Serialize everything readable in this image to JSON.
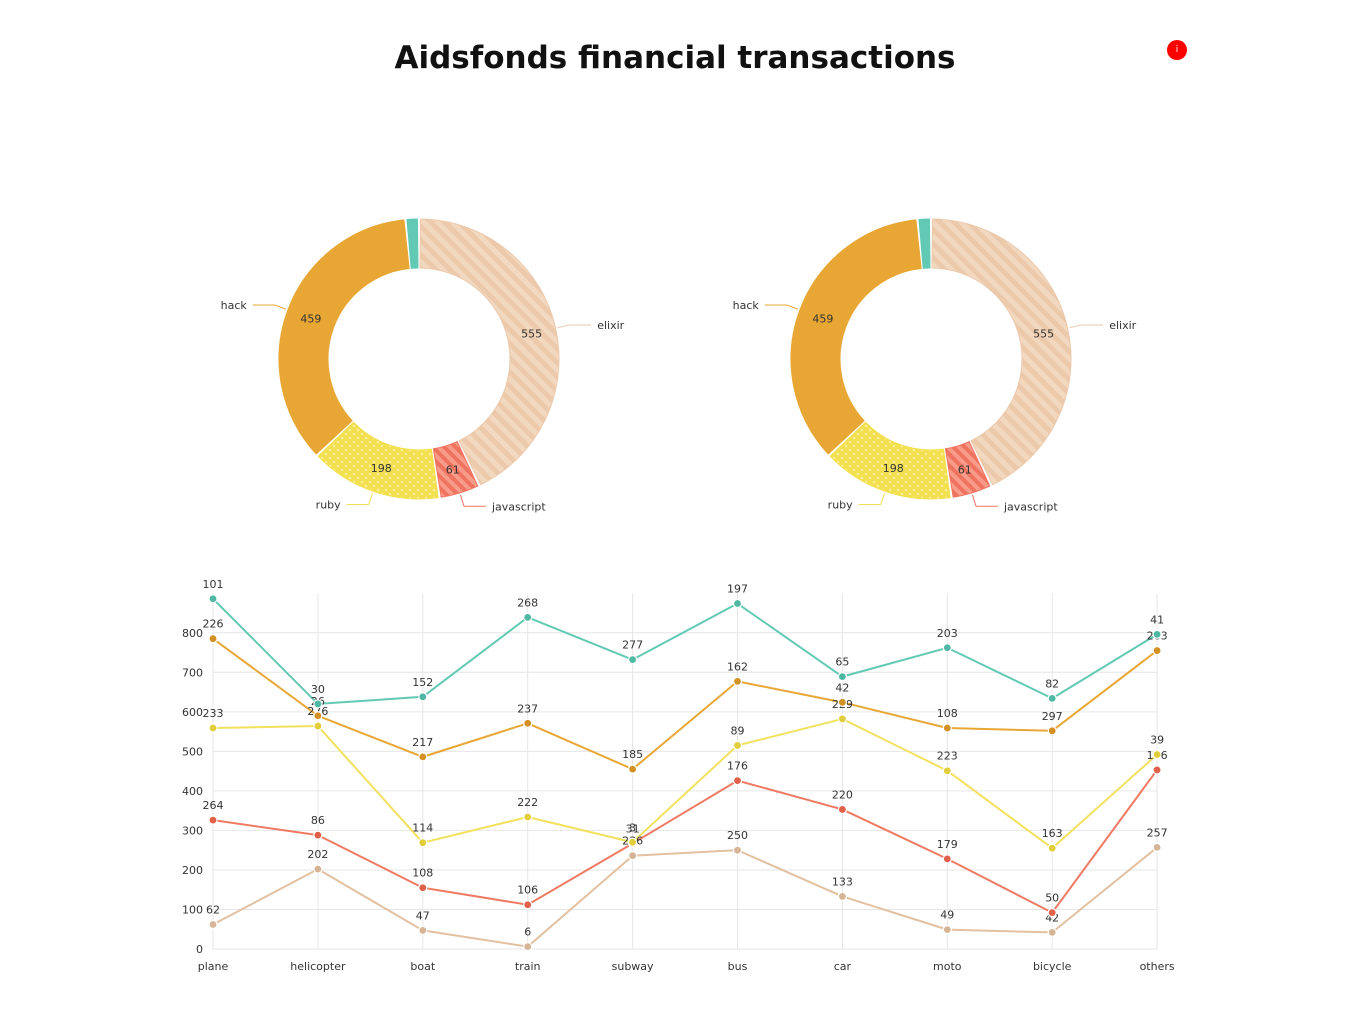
{
  "title": "Aidsfonds financial transactions",
  "info_button_label": "i",
  "chart_data": [
    {
      "type": "pie",
      "variant": "donut",
      "slices": [
        {
          "label": "elixir",
          "value": 555,
          "color": "#ecc9ab",
          "pattern": "diagonal-stripes"
        },
        {
          "label": "javascript",
          "value": 61,
          "color": "#f0735f",
          "pattern": "diagonal-stripes"
        },
        {
          "label": "ruby",
          "value": 198,
          "color": "#f2e04f",
          "pattern": "dots"
        },
        {
          "label": "hack",
          "value": 459,
          "color": "#e8a735",
          "pattern": "none"
        },
        {
          "label": "",
          "value": 20,
          "color": "#62cab4",
          "pattern": "none"
        }
      ]
    },
    {
      "type": "pie",
      "variant": "donut",
      "slices": [
        {
          "label": "elixir",
          "value": 555,
          "color": "#ecc9ab",
          "pattern": "diagonal-stripes"
        },
        {
          "label": "javascript",
          "value": 61,
          "color": "#f0735f",
          "pattern": "diagonal-stripes"
        },
        {
          "label": "ruby",
          "value": 198,
          "color": "#f2e04f",
          "pattern": "dots"
        },
        {
          "label": "hack",
          "value": 459,
          "color": "#e8a735",
          "pattern": "none"
        },
        {
          "label": "",
          "value": 20,
          "color": "#62cab4",
          "pattern": "none"
        }
      ]
    },
    {
      "type": "line",
      "stacked": true,
      "categories": [
        "plane",
        "helicopter",
        "boat",
        "train",
        "subway",
        "bus",
        "car",
        "moto",
        "bicycle",
        "others"
      ],
      "ylim": [
        0,
        900
      ],
      "yticks": [
        0,
        100,
        200,
        300,
        400,
        500,
        600,
        700,
        800
      ],
      "grid": true,
      "series": [
        {
          "color": "#e2c0a0",
          "point_color": "#d6b596",
          "values": [
            62,
            202,
            47,
            6,
            236,
            250,
            133,
            49,
            42,
            257
          ]
        },
        {
          "color": "#ef7a63",
          "point_color": "#e0604a",
          "values": [
            264,
            86,
            108,
            106,
            31,
            176,
            220,
            179,
            50,
            196
          ]
        },
        {
          "color": "#f2e15c",
          "point_color": "#e2cd3a",
          "values": [
            233,
            276,
            114,
            222,
            3,
            89,
            229,
            223,
            163,
            39
          ]
        },
        {
          "color": "#e8a735",
          "point_color": "#d39024",
          "values": [
            226,
            26,
            217,
            237,
            185,
            162,
            42,
            108,
            297,
            263
          ]
        },
        {
          "color": "#62cab4",
          "point_color": "#4fb8a2",
          "values": [
            101,
            30,
            152,
            268,
            277,
            197,
            65,
            203,
            82,
            41
          ]
        }
      ]
    }
  ]
}
